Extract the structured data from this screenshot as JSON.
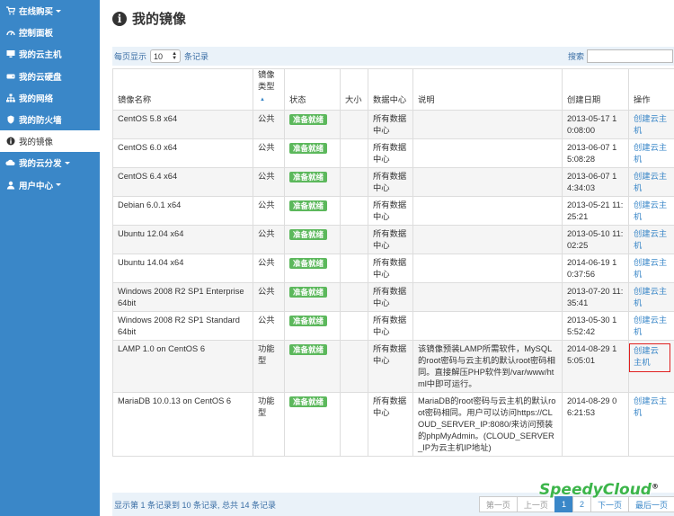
{
  "sidebar": {
    "items": [
      {
        "label": "在线购买",
        "icon": "cart-icon",
        "caret": true,
        "active": false
      },
      {
        "label": "控制面板",
        "icon": "dashboard-icon",
        "caret": false,
        "active": false
      },
      {
        "label": "我的云主机",
        "icon": "monitor-icon",
        "caret": false,
        "active": false
      },
      {
        "label": "我的云硬盘",
        "icon": "disk-icon",
        "caret": false,
        "active": false
      },
      {
        "label": "我的网络",
        "icon": "network-icon",
        "caret": false,
        "active": false
      },
      {
        "label": "我的防火墙",
        "icon": "shield-icon",
        "caret": false,
        "active": false
      },
      {
        "label": "我的镜像",
        "icon": "info-icon",
        "caret": false,
        "active": true
      },
      {
        "label": "我的云分发",
        "icon": "cloud-icon",
        "caret": true,
        "active": false
      },
      {
        "label": "用户中心",
        "icon": "user-icon",
        "caret": true,
        "active": false
      }
    ]
  },
  "header": {
    "title": "我的镜像"
  },
  "toolbar": {
    "per_page_prefix": "每页显示",
    "per_page_value": "10",
    "per_page_suffix": "条记录",
    "search_label": "搜索"
  },
  "table": {
    "columns": [
      "镜像名称",
      "镜像类型",
      "状态",
      "大小",
      "数据中心",
      "说明",
      "创建日期",
      "操作"
    ],
    "rows": [
      {
        "name": "CentOS 5.8 x64",
        "type": "公共",
        "status": "准备就绪",
        "size": "",
        "dc": "所有数据中心",
        "desc": "",
        "date": "2013-05-17 10:08:00",
        "action": "创建云主机"
      },
      {
        "name": "CentOS 6.0 x64",
        "type": "公共",
        "status": "准备就绪",
        "size": "",
        "dc": "所有数据中心",
        "desc": "",
        "date": "2013-06-07 15:08:28",
        "action": "创建云主机"
      },
      {
        "name": "CentOS 6.4 x64",
        "type": "公共",
        "status": "准备就绪",
        "size": "",
        "dc": "所有数据中心",
        "desc": "",
        "date": "2013-06-07 14:34:03",
        "action": "创建云主机"
      },
      {
        "name": "Debian 6.0.1 x64",
        "type": "公共",
        "status": "准备就绪",
        "size": "",
        "dc": "所有数据中心",
        "desc": "",
        "date": "2013-05-21 11:25:21",
        "action": "创建云主机"
      },
      {
        "name": "Ubuntu 12.04 x64",
        "type": "公共",
        "status": "准备就绪",
        "size": "",
        "dc": "所有数据中心",
        "desc": "",
        "date": "2013-05-10 11:02:25",
        "action": "创建云主机"
      },
      {
        "name": "Ubuntu 14.04 x64",
        "type": "公共",
        "status": "准备就绪",
        "size": "",
        "dc": "所有数据中心",
        "desc": "",
        "date": "2014-06-19 10:37:56",
        "action": "创建云主机"
      },
      {
        "name": "Windows 2008 R2 SP1 Enterprise 64bit",
        "type": "公共",
        "status": "准备就绪",
        "size": "",
        "dc": "所有数据中心",
        "desc": "",
        "date": "2013-07-20 11:35:41",
        "action": "创建云主机"
      },
      {
        "name": "Windows 2008 R2 SP1 Standard 64bit",
        "type": "公共",
        "status": "准备就绪",
        "size": "",
        "dc": "所有数据中心",
        "desc": "",
        "date": "2013-05-30 15:52:42",
        "action": "创建云主机"
      },
      {
        "name": "LAMP 1.0 on CentOS 6",
        "type": "功能型",
        "status": "准备就绪",
        "size": "",
        "dc": "所有数据中心",
        "desc": "该镜像预装LAMP所需软件，MySQL的root密码与云主机的默认root密码相同。直接解压PHP软件到/var/www/html中即可运行。",
        "date": "2014-08-29 15:05:01",
        "action": "创建云主机"
      },
      {
        "name": "MariaDB 10.0.13 on CentOS 6",
        "type": "功能型",
        "status": "准备就绪",
        "size": "",
        "dc": "所有数据中心",
        "desc": "MariaDB的root密码与云主机的默认root密码相同。用户可以访问https://CLOUD_SERVER_IP:8080/来访问预装的phpMyAdmin。(CLOUD_SERVER_IP为云主机IP地址)",
        "date": "2014-08-29 06:21:53",
        "action": "创建云主机"
      }
    ]
  },
  "footer": {
    "info": "显示第 1 条记录到 10 条记录, 总共 14 条记录",
    "pager": [
      "第一页",
      "上一页",
      "1",
      "2",
      "下一页",
      "最后一页"
    ]
  },
  "logo": {
    "text": "SpeedyCloud",
    "mark": "®"
  },
  "colors": {
    "sidebar": "#3a87c8",
    "badge": "#5cb85c",
    "link": "#3a87c8",
    "highlight": "#e02020"
  }
}
